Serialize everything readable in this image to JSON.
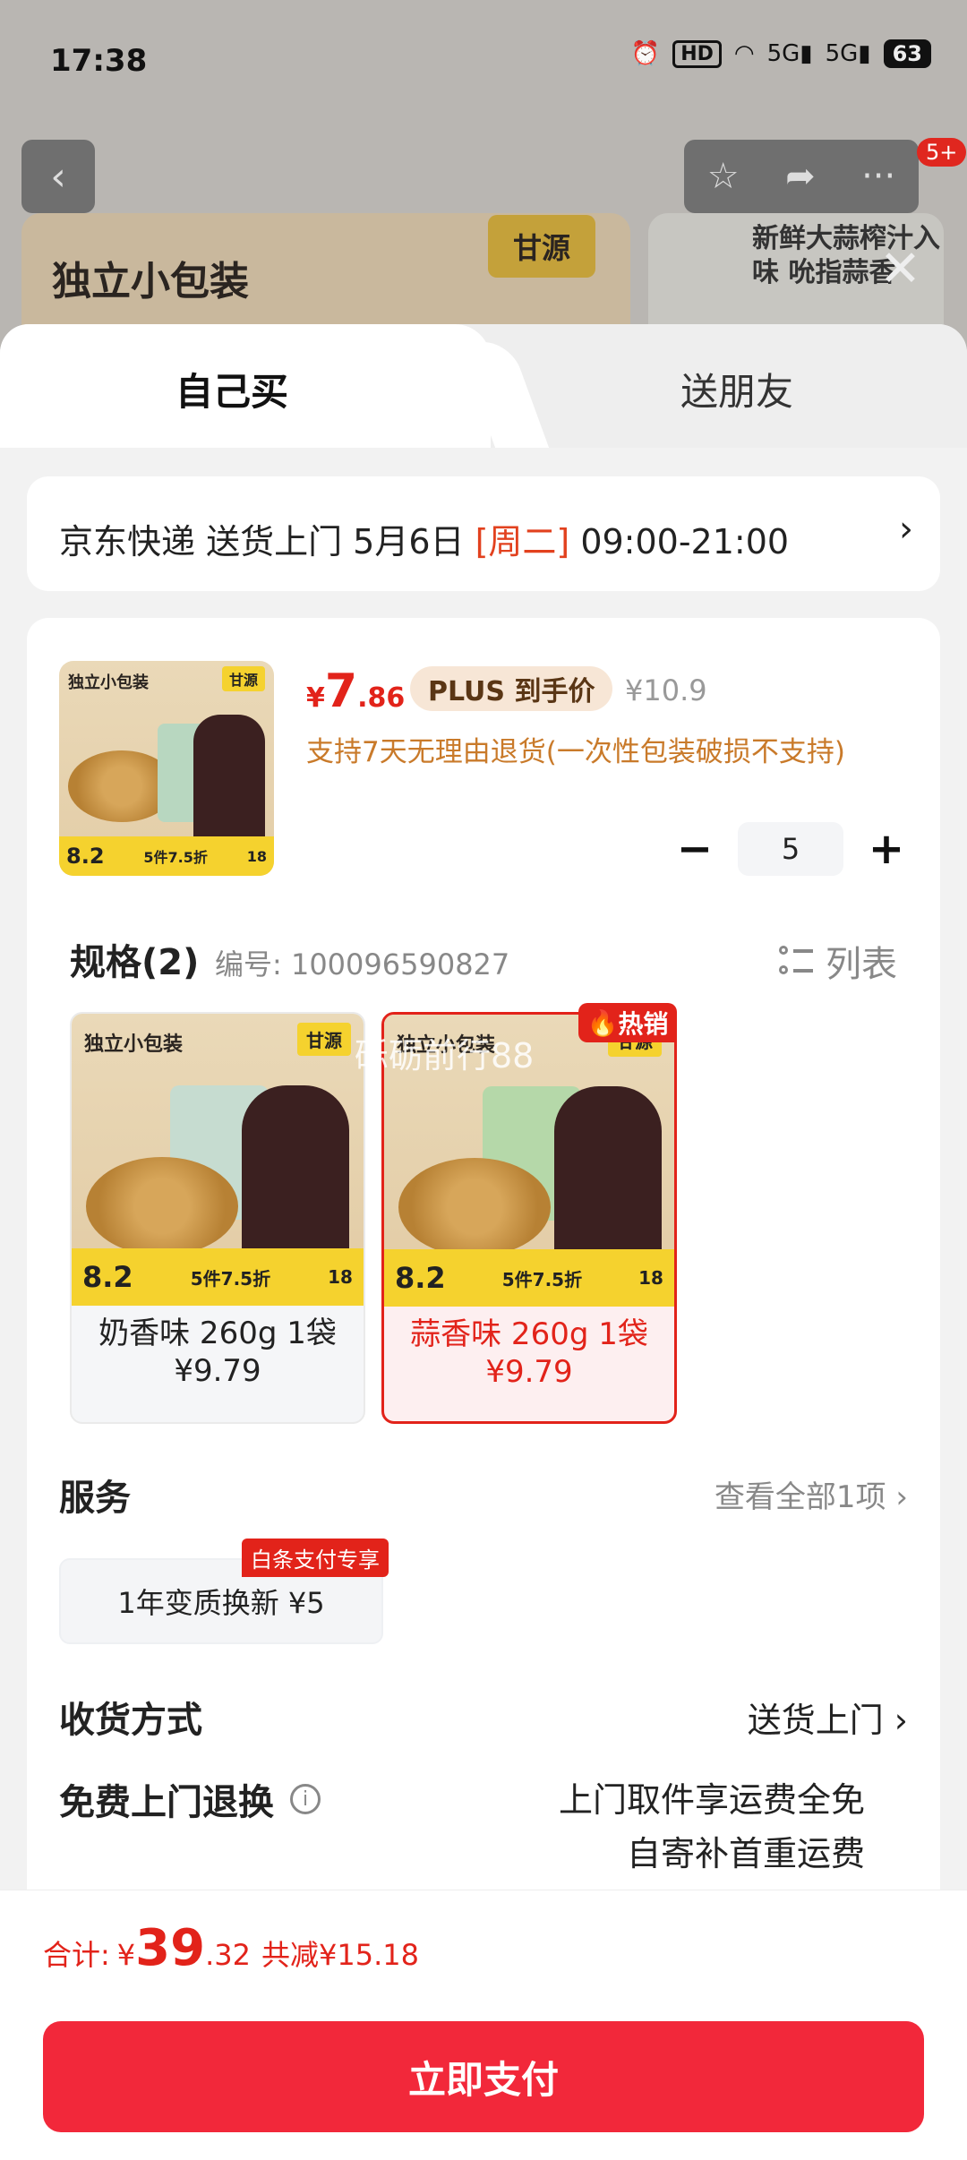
{
  "status_bar": {
    "time": "17:38",
    "icons": [
      "alarm-icon",
      "hd-icon",
      "wifi-icon",
      "5g-signal-icon",
      "5g-signal-icon",
      "battery-icon"
    ],
    "hd": "HD",
    "net1": "5G",
    "net2": "5G",
    "battery": "63"
  },
  "background": {
    "banner_title": "独立小包装",
    "brand": "甘源",
    "banner_right_text": "新鲜大蒜榨汁入味 吮指蒜香",
    "cart_badge": "5+"
  },
  "tabs": [
    {
      "label": "自己买",
      "active": true
    },
    {
      "label": "送朋友",
      "active": false
    }
  ],
  "delivery": {
    "text_prefix": "京东快递 送货上门 5月6日 ",
    "weekday": "[周二]",
    "time_range": " 09:00-21:00"
  },
  "product": {
    "thumb_title": "独立小包装",
    "thumb_brand": "甘源",
    "thumb_price": "8.2",
    "thumb_promo": "5件7.5折",
    "thumb_coupon": "18",
    "price_symbol": "¥",
    "price_int": "7",
    "price_dec": ".86",
    "plus_tag": "PLUS 到手价",
    "original_price": "¥10.9",
    "return_policy": "支持7天无理由退货(一次性包装破损不支持)",
    "quantity": "5"
  },
  "spec": {
    "title": "规格(2)",
    "code": "编号: 100096590827",
    "list_label": "列表",
    "hot_badge": "热销",
    "watermark": "砾砺前行88",
    "options": [
      {
        "img_title": "独立小包装",
        "brand": "甘源",
        "strip_price": "8.2",
        "strip_promo": "5件7.5折",
        "strip_coupon": "18",
        "label": "奶香味 260g 1袋",
        "price": "¥9.79",
        "selected": false
      },
      {
        "img_title": "独立小包装",
        "brand": "甘源",
        "strip_price": "8.2",
        "strip_promo": "5件7.5折",
        "strip_coupon": "18",
        "label": "蒜香味 260g 1袋",
        "price": "¥9.79",
        "selected": true
      }
    ]
  },
  "service": {
    "title": "服务",
    "view_all": "查看全部1项",
    "chip": "1年变质换新 ¥5",
    "tag": "白条支付专享"
  },
  "shipping": {
    "title": "收货方式",
    "value": "送货上门"
  },
  "returns": {
    "title": "免费上门退换",
    "line1": "上门取件享运费全免",
    "line2": "自寄补首重运费"
  },
  "footer": {
    "total_label": "合计:",
    "total_symbol": "¥",
    "total_int": "39",
    "total_dec": ".32",
    "discount": "共减¥15.18",
    "pay_button": "立即支付"
  },
  "colors": {
    "accent": "#e2231a",
    "pay_button": "#f2283a",
    "policy": "#c97a2a",
    "plus_bg": "#f7e6d6"
  }
}
